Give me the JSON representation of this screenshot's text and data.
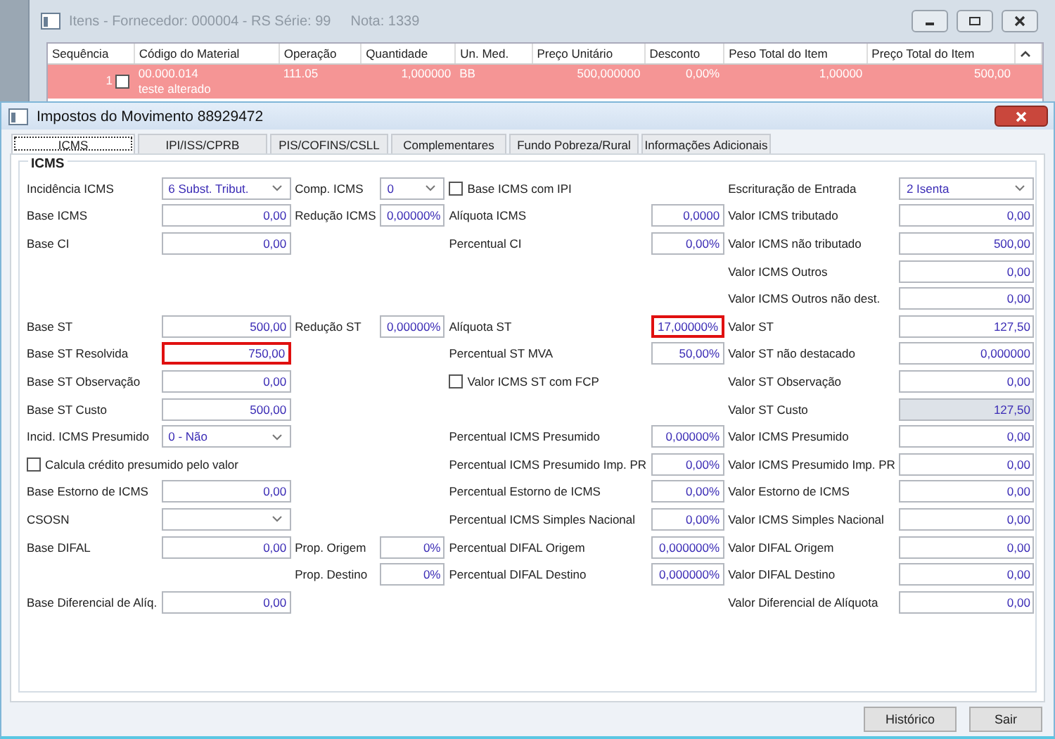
{
  "background_window": {
    "title": "Itens - Fornecedor: 000004 - RS Série: 99",
    "title_extra": "Nota: 1339",
    "columns": [
      "Sequência",
      "Código do Material",
      "Operação",
      "Quantidade",
      "Un. Med.",
      "Preço Unitário",
      "Desconto",
      "Peso Total do Item",
      "Preço Total do Item"
    ],
    "rows": [
      {
        "checked": false,
        "selected": true,
        "note": "teste alterado",
        "cells": [
          "1",
          "00.000.014",
          "111.05",
          "1,000000",
          "BB",
          "500,000000",
          "0,00%",
          "1,00000",
          "500,00"
        ]
      }
    ]
  },
  "dialog": {
    "title": "Impostos do Movimento 88929472",
    "tabs": [
      {
        "label": "ICMS",
        "selected": true
      },
      {
        "label": "IPI/ISS/CPRB",
        "selected": false
      },
      {
        "label": "PIS/COFINS/CSLL",
        "selected": false
      },
      {
        "label": "Complementares",
        "selected": false
      },
      {
        "label": "Fundo Pobreza/Rural",
        "selected": false
      },
      {
        "label": "Informações Adicionais",
        "selected": false
      }
    ],
    "group_title": "ICMS",
    "rows": [
      {
        "col_a": {
          "kind": "select",
          "label": "Incidência ICMS",
          "value": "6 Subst. Tribut."
        },
        "col_b": {
          "kind": "select",
          "label": "Comp. ICMS",
          "value": "0"
        },
        "col_c": {
          "kind": "checkbox",
          "label": "Base ICMS com IPI",
          "checked": false
        },
        "col_d": {
          "kind": "select",
          "label": "Escrituração de Entrada",
          "value": "2 Isenta"
        }
      },
      {
        "col_a": {
          "kind": "field",
          "label": "Base ICMS",
          "value": "0,00",
          "highlighted": false,
          "readonly": false
        },
        "col_b": {
          "kind": "field",
          "label": "Redução ICMS",
          "value": "0,00000%",
          "highlighted": false,
          "readonly": false
        },
        "col_c": {
          "kind": "field",
          "label": "Alíquota ICMS",
          "value": "0,0000",
          "highlighted": false,
          "readonly": false
        },
        "col_d": {
          "kind": "field",
          "label": "Valor ICMS tributado",
          "value": "0,00",
          "highlighted": false,
          "readonly": false
        }
      },
      {
        "col_a": {
          "kind": "field",
          "label": "Base CI",
          "value": "0,00",
          "highlighted": false,
          "readonly": false
        },
        "col_c": {
          "kind": "field",
          "label": "Percentual CI",
          "value": "0,00%",
          "highlighted": false,
          "readonly": false
        },
        "col_d": {
          "kind": "field",
          "label": "Valor ICMS não tributado",
          "value": "500,00",
          "highlighted": false,
          "readonly": false
        }
      },
      {
        "col_d": {
          "kind": "field",
          "label": "Valor ICMS Outros",
          "value": "0,00",
          "highlighted": false,
          "readonly": false
        }
      },
      {
        "col_d": {
          "kind": "field",
          "label": "Valor ICMS Outros não dest.",
          "value": "0,00",
          "highlighted": false,
          "readonly": false
        }
      },
      {
        "col_a": {
          "kind": "field",
          "label": "Base ST",
          "value": "500,00",
          "highlighted": false,
          "readonly": false
        },
        "col_b": {
          "kind": "field",
          "label": "Redução ST",
          "value": "0,00000%",
          "highlighted": false,
          "readonly": false
        },
        "col_c": {
          "kind": "field",
          "label": "Alíquota ST",
          "value": "17,00000%",
          "highlighted": true,
          "readonly": false
        },
        "col_d": {
          "kind": "field",
          "label": "Valor ST",
          "value": "127,50",
          "highlighted": false,
          "readonly": false
        }
      },
      {
        "col_a": {
          "kind": "field",
          "label": "Base ST Resolvida",
          "value": "750,00",
          "highlighted": true,
          "readonly": false
        },
        "col_c": {
          "kind": "field",
          "label": "Percentual ST MVA",
          "value": "50,00%",
          "highlighted": false,
          "readonly": false
        },
        "col_d": {
          "kind": "field",
          "label": "Valor ST não destacado",
          "value": "0,000000",
          "highlighted": false,
          "readonly": false
        }
      },
      {
        "col_a": {
          "kind": "field",
          "label": "Base ST Observação",
          "value": "0,00",
          "highlighted": false,
          "readonly": false
        },
        "col_c": {
          "kind": "checkbox",
          "label": "Valor ICMS ST com FCP",
          "checked": false
        },
        "col_d": {
          "kind": "field",
          "label": "Valor ST Observação",
          "value": "0,00",
          "highlighted": false,
          "readonly": false
        }
      },
      {
        "col_a": {
          "kind": "field",
          "label": "Base ST Custo",
          "value": "500,00",
          "highlighted": false,
          "readonly": false
        },
        "col_d": {
          "kind": "field",
          "label": "Valor ST Custo",
          "value": "127,50",
          "highlighted": false,
          "readonly": true
        }
      },
      {
        "col_a": {
          "kind": "select",
          "label": "Incid. ICMS Presumido",
          "value": "0 - Não"
        },
        "col_c": {
          "kind": "field",
          "label": "Percentual ICMS Presumido",
          "value": "0,00000%",
          "highlighted": false,
          "readonly": false
        },
        "col_d": {
          "kind": "field",
          "label": "Valor ICMS Presumido",
          "value": "0,00",
          "highlighted": false,
          "readonly": false
        }
      },
      {
        "col_a": {
          "kind": "checkbox",
          "label": "Calcula crédito presumido pelo valor",
          "checked": false
        },
        "col_c": {
          "kind": "field",
          "label": "Percentual ICMS Presumido Imp. PR",
          "value": "0,00%",
          "highlighted": false,
          "readonly": false
        },
        "col_d": {
          "kind": "field",
          "label": "Valor ICMS Presumido Imp. PR",
          "value": "0,00",
          "highlighted": false,
          "readonly": false
        }
      },
      {
        "col_a": {
          "kind": "field",
          "label": "Base Estorno de ICMS",
          "value": "0,00",
          "highlighted": false,
          "readonly": false
        },
        "col_c": {
          "kind": "field",
          "label": "Percentual Estorno de ICMS",
          "value": "0,00%",
          "highlighted": false,
          "readonly": false
        },
        "col_d": {
          "kind": "field",
          "label": "Valor Estorno de ICMS",
          "value": "0,00",
          "highlighted": false,
          "readonly": false
        }
      },
      {
        "col_a": {
          "kind": "select",
          "label": "CSOSN"
        },
        "col_c": {
          "kind": "field",
          "label": "Percentual ICMS Simples Nacional",
          "value": "0,00%",
          "highlighted": false,
          "readonly": false
        },
        "col_d": {
          "kind": "field",
          "label": "Valor ICMS Simples Nacional",
          "value": "0,00",
          "highlighted": false,
          "readonly": false
        }
      },
      {
        "col_a": {
          "kind": "field",
          "label": "Base DIFAL",
          "value": "0,00",
          "highlighted": false,
          "readonly": false
        },
        "col_b": {
          "kind": "field",
          "label": "Prop. Origem",
          "value": "0%",
          "highlighted": false,
          "readonly": false
        },
        "col_c": {
          "kind": "field",
          "label": "Percentual DIFAL Origem",
          "value": "0,000000%",
          "highlighted": false,
          "readonly": false
        },
        "col_d": {
          "kind": "field",
          "label": "Valor DIFAL Origem",
          "value": "0,00",
          "highlighted": false,
          "readonly": false
        }
      },
      {
        "col_b": {
          "kind": "field",
          "label": "Prop. Destino",
          "value": "0%",
          "highlighted": false,
          "readonly": false
        },
        "col_c": {
          "kind": "field",
          "label": "Percentual DIFAL Destino",
          "value": "0,000000%",
          "highlighted": false,
          "readonly": false
        },
        "col_d": {
          "kind": "field",
          "label": "Valor DIFAL Destino",
          "value": "0,00",
          "highlighted": false,
          "readonly": false
        }
      },
      {
        "col_a": {
          "kind": "field",
          "label": "Base Diferencial de Alíq.",
          "value": "0,00",
          "highlighted": false,
          "readonly": false
        },
        "col_d": {
          "kind": "field",
          "label": "Valor Diferencial de Alíquota",
          "value": "0,00",
          "highlighted": false,
          "readonly": false
        }
      }
    ],
    "buttons": [
      "Histórico",
      "Sair"
    ]
  }
}
